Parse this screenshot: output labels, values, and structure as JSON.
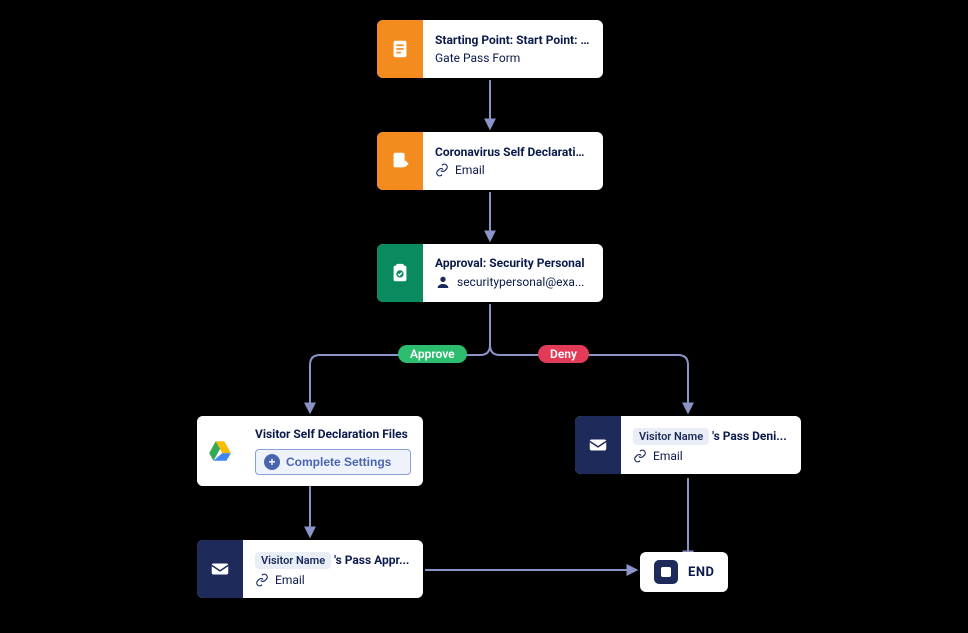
{
  "branches": {
    "approve": "Approve",
    "deny": "Deny"
  },
  "nodes": {
    "start": {
      "title": "Starting Point: Start Point: Vi...",
      "subtitle": "Gate Pass Form",
      "icon": "document-icon",
      "icon_color": "#f38b1e"
    },
    "declaration": {
      "title": "Coronavirus Self Declaration...",
      "link_label": "Email",
      "icon": "document-arrow-icon",
      "icon_color": "#f38b1e"
    },
    "approval": {
      "title": "Approval: Security Personal",
      "person_label": "securitypersonal@exa...",
      "icon": "clipboard-check-icon",
      "icon_color": "#0a8a5f"
    },
    "drive": {
      "title": "Visitor Self Declaration Files",
      "button_label": "Complete Settings",
      "icon": "google-drive-icon"
    },
    "pass_approved": {
      "chip": "Visitor Name",
      "title_suffix": "'s Pass Appr...",
      "link_label": "Email",
      "icon": "envelope-icon",
      "icon_color": "#1e2a5a"
    },
    "pass_denied": {
      "chip": "Visitor Name",
      "title_suffix": "'s Pass Deni...",
      "link_label": "Email",
      "icon": "envelope-icon",
      "icon_color": "#1e2a5a"
    },
    "end": {
      "label": "END",
      "icon": "stop-icon"
    }
  },
  "colors": {
    "connector": "#8a94c6",
    "approve": "#2dbd6e",
    "deny": "#e23b57"
  }
}
